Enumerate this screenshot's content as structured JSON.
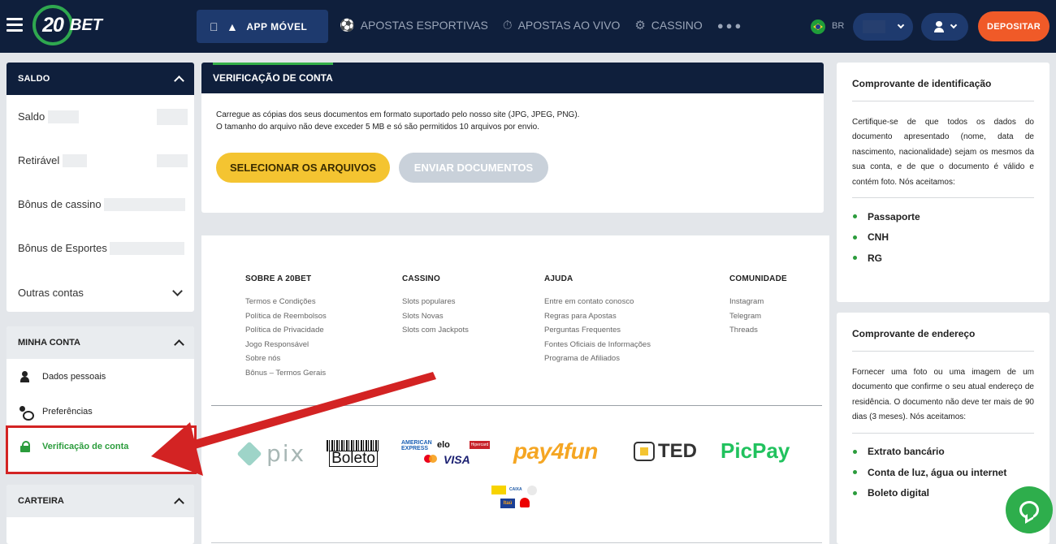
{
  "header": {
    "logo_number": "20",
    "logo_text": "BET",
    "app_button": "APP MÓVEL",
    "nav": [
      "APOSTAS ESPORTIVAS",
      "APOSTAS AO VIVO",
      "CASSINO"
    ],
    "lang": "BR",
    "deposit": "DEPOSITAR"
  },
  "sidebar": {
    "balance_title": "SALDO",
    "balance_rows": [
      "Saldo",
      "Retirável",
      "Bônus de cassino",
      "Bônus de Esportes",
      "Outras contas"
    ],
    "account_title": "MINHA CONTA",
    "account_items": [
      "Dados pessoais",
      "Preferências",
      "Verificação de conta"
    ],
    "wallet_title": "CARTEIRA"
  },
  "verification": {
    "title": "VERIFICAÇÃO DE CONTA",
    "line1": "Carregue as cópias dos seus documentos em formato suportado pelo nosso site (JPG, JPEG, PNG).",
    "line2": "O tamanho do arquivo não deve exceder 5 MB e só são permitidos 10 arquivos por envio.",
    "select_button": "SELECIONAR OS ARQUIVOS",
    "send_button": "ENVIAR DOCUMENTOS"
  },
  "footer": {
    "columns": [
      {
        "title": "SOBRE A 20BET",
        "links": [
          "Termos e Condições",
          "Política de Reembolsos",
          "Política de Privacidade",
          "Jogo Responsável",
          "Sobre nós",
          "Bônus – Termos Gerais"
        ]
      },
      {
        "title": "CASSINO",
        "links": [
          "Slots populares",
          "Slots Novas",
          "Slots com Jackpots"
        ]
      },
      {
        "title": "AJUDA",
        "links": [
          "Entre em contato conosco",
          "Regras para Apostas",
          "Perguntas Frequentes",
          "Fontes Oficiais de Informações",
          "Programa de Afiliados"
        ]
      },
      {
        "title": "COMUNIDADE",
        "links": [
          "Instagram",
          "Telegram",
          "Threads"
        ]
      }
    ],
    "payments": {
      "pix": "pix",
      "boleto": "Boleto",
      "amex": "AMERICAN EXPRESS",
      "elo": "elo",
      "hipercard": "Hipercard",
      "visa": "VISA",
      "payfun": "pay4fun",
      "ted": "TED",
      "picpay": "PicPay",
      "caixa": "CAIXA",
      "itau": "Itaú"
    }
  },
  "id_card": {
    "title": "Comprovante de identificação",
    "text": "Certifique-se de que todos os dados do documento apresentado (nome, data de nascimento, nacionalidade) sejam os mesmos da sua conta, e de que o documento é válido e contém foto. Nós aceitamos:",
    "items": [
      "Passaporte",
      "CNH",
      "RG"
    ]
  },
  "address_card": {
    "title": "Comprovante de endereço",
    "text": "Fornecer uma foto ou uma imagem de um documento que confirme o seu atual endereço de residência. O documento não deve ter mais de 90 dias (3 meses). Nós aceitamos:",
    "items": [
      "Extrato bancário",
      "Conta de luz, água ou internet",
      "Boleto digital"
    ]
  },
  "colors": {
    "navy": "#0f1f3c",
    "green": "#2b9c3c",
    "orange": "#f05a28",
    "yellow": "#f4c431",
    "red": "#d32323"
  }
}
